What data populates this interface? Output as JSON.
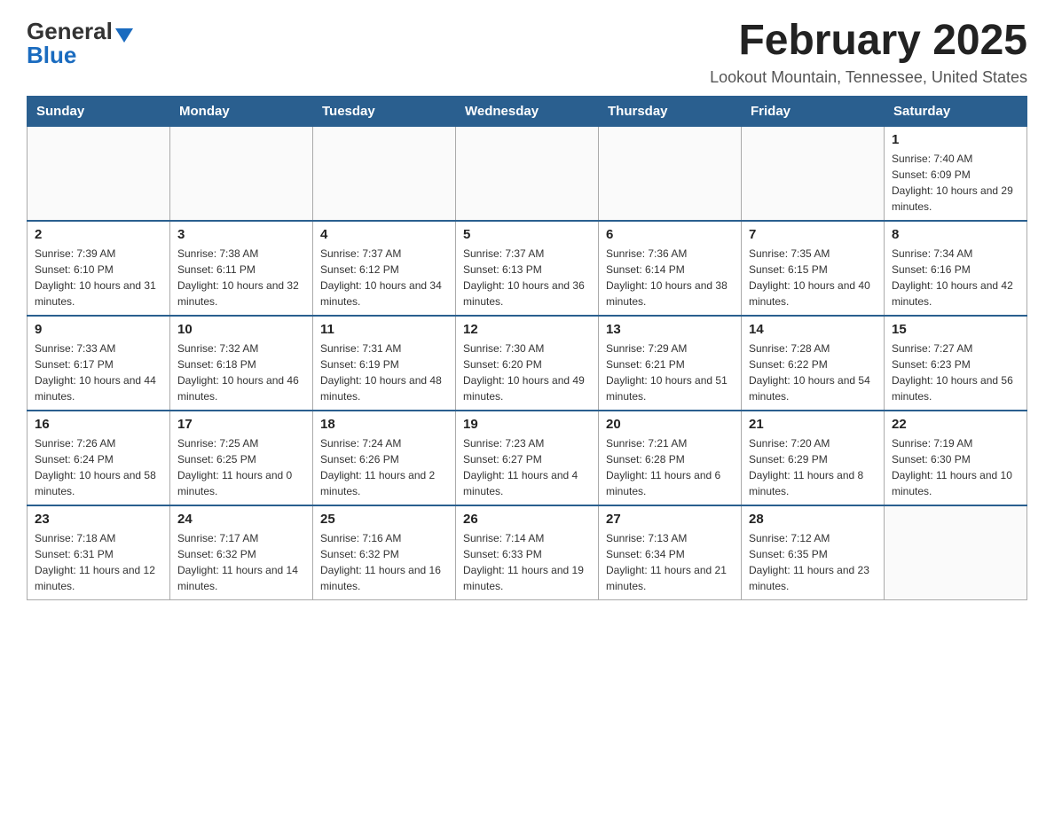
{
  "header": {
    "logo_general": "General",
    "logo_blue": "Blue",
    "month_title": "February 2025",
    "location": "Lookout Mountain, Tennessee, United States"
  },
  "days_of_week": [
    "Sunday",
    "Monday",
    "Tuesday",
    "Wednesday",
    "Thursday",
    "Friday",
    "Saturday"
  ],
  "weeks": [
    [
      {
        "day": "",
        "info": ""
      },
      {
        "day": "",
        "info": ""
      },
      {
        "day": "",
        "info": ""
      },
      {
        "day": "",
        "info": ""
      },
      {
        "day": "",
        "info": ""
      },
      {
        "day": "",
        "info": ""
      },
      {
        "day": "1",
        "info": "Sunrise: 7:40 AM\nSunset: 6:09 PM\nDaylight: 10 hours and 29 minutes."
      }
    ],
    [
      {
        "day": "2",
        "info": "Sunrise: 7:39 AM\nSunset: 6:10 PM\nDaylight: 10 hours and 31 minutes."
      },
      {
        "day": "3",
        "info": "Sunrise: 7:38 AM\nSunset: 6:11 PM\nDaylight: 10 hours and 32 minutes."
      },
      {
        "day": "4",
        "info": "Sunrise: 7:37 AM\nSunset: 6:12 PM\nDaylight: 10 hours and 34 minutes."
      },
      {
        "day": "5",
        "info": "Sunrise: 7:37 AM\nSunset: 6:13 PM\nDaylight: 10 hours and 36 minutes."
      },
      {
        "day": "6",
        "info": "Sunrise: 7:36 AM\nSunset: 6:14 PM\nDaylight: 10 hours and 38 minutes."
      },
      {
        "day": "7",
        "info": "Sunrise: 7:35 AM\nSunset: 6:15 PM\nDaylight: 10 hours and 40 minutes."
      },
      {
        "day": "8",
        "info": "Sunrise: 7:34 AM\nSunset: 6:16 PM\nDaylight: 10 hours and 42 minutes."
      }
    ],
    [
      {
        "day": "9",
        "info": "Sunrise: 7:33 AM\nSunset: 6:17 PM\nDaylight: 10 hours and 44 minutes."
      },
      {
        "day": "10",
        "info": "Sunrise: 7:32 AM\nSunset: 6:18 PM\nDaylight: 10 hours and 46 minutes."
      },
      {
        "day": "11",
        "info": "Sunrise: 7:31 AM\nSunset: 6:19 PM\nDaylight: 10 hours and 48 minutes."
      },
      {
        "day": "12",
        "info": "Sunrise: 7:30 AM\nSunset: 6:20 PM\nDaylight: 10 hours and 49 minutes."
      },
      {
        "day": "13",
        "info": "Sunrise: 7:29 AM\nSunset: 6:21 PM\nDaylight: 10 hours and 51 minutes."
      },
      {
        "day": "14",
        "info": "Sunrise: 7:28 AM\nSunset: 6:22 PM\nDaylight: 10 hours and 54 minutes."
      },
      {
        "day": "15",
        "info": "Sunrise: 7:27 AM\nSunset: 6:23 PM\nDaylight: 10 hours and 56 minutes."
      }
    ],
    [
      {
        "day": "16",
        "info": "Sunrise: 7:26 AM\nSunset: 6:24 PM\nDaylight: 10 hours and 58 minutes."
      },
      {
        "day": "17",
        "info": "Sunrise: 7:25 AM\nSunset: 6:25 PM\nDaylight: 11 hours and 0 minutes."
      },
      {
        "day": "18",
        "info": "Sunrise: 7:24 AM\nSunset: 6:26 PM\nDaylight: 11 hours and 2 minutes."
      },
      {
        "day": "19",
        "info": "Sunrise: 7:23 AM\nSunset: 6:27 PM\nDaylight: 11 hours and 4 minutes."
      },
      {
        "day": "20",
        "info": "Sunrise: 7:21 AM\nSunset: 6:28 PM\nDaylight: 11 hours and 6 minutes."
      },
      {
        "day": "21",
        "info": "Sunrise: 7:20 AM\nSunset: 6:29 PM\nDaylight: 11 hours and 8 minutes."
      },
      {
        "day": "22",
        "info": "Sunrise: 7:19 AM\nSunset: 6:30 PM\nDaylight: 11 hours and 10 minutes."
      }
    ],
    [
      {
        "day": "23",
        "info": "Sunrise: 7:18 AM\nSunset: 6:31 PM\nDaylight: 11 hours and 12 minutes."
      },
      {
        "day": "24",
        "info": "Sunrise: 7:17 AM\nSunset: 6:32 PM\nDaylight: 11 hours and 14 minutes."
      },
      {
        "day": "25",
        "info": "Sunrise: 7:16 AM\nSunset: 6:32 PM\nDaylight: 11 hours and 16 minutes."
      },
      {
        "day": "26",
        "info": "Sunrise: 7:14 AM\nSunset: 6:33 PM\nDaylight: 11 hours and 19 minutes."
      },
      {
        "day": "27",
        "info": "Sunrise: 7:13 AM\nSunset: 6:34 PM\nDaylight: 11 hours and 21 minutes."
      },
      {
        "day": "28",
        "info": "Sunrise: 7:12 AM\nSunset: 6:35 PM\nDaylight: 11 hours and 23 minutes."
      },
      {
        "day": "",
        "info": ""
      }
    ]
  ]
}
